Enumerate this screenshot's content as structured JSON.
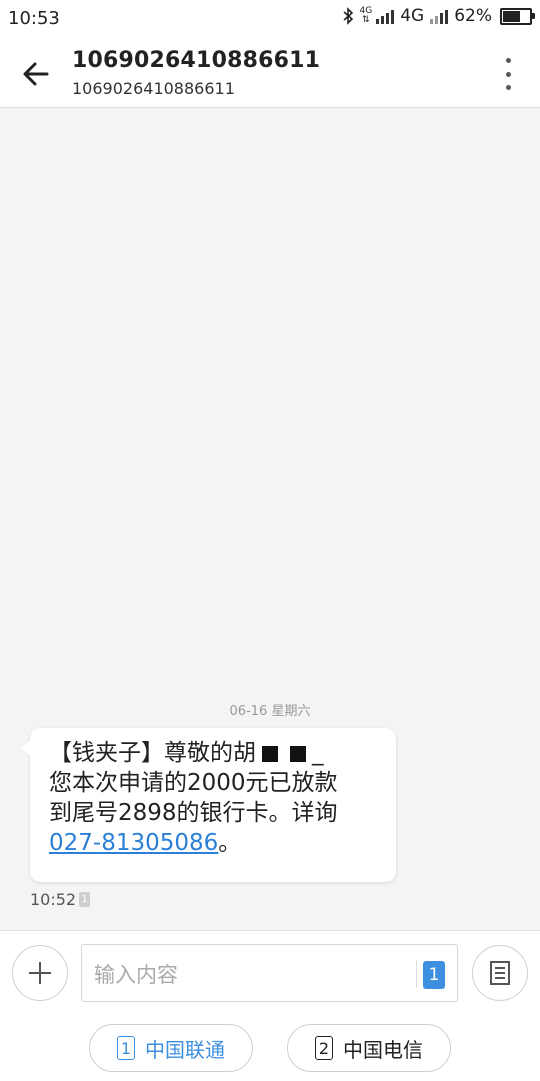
{
  "status_bar": {
    "time": "10:53",
    "network_small": "4G",
    "network": "4G",
    "battery_text": "62%",
    "battery_level": 0.62
  },
  "header": {
    "title": "1069026410886611",
    "subtitle": "1069026410886611"
  },
  "conversation": {
    "date_label": "06-16  星期六",
    "message": {
      "line1": "【钱夹子】尊敬的胡",
      "line1_tail": "_",
      "line2": "您本次申请的2000元已放款",
      "line3": "到尾号2898的银行卡。详询",
      "link": "027-81305086",
      "line4_suffix": "。",
      "time": "10:52",
      "sim_badge": "1"
    }
  },
  "input": {
    "placeholder": "输入内容",
    "sim_badge": "1"
  },
  "sim_buttons": [
    {
      "number": "1",
      "label": "中国联通"
    },
    {
      "number": "2",
      "label": "中国电信"
    }
  ],
  "colors": {
    "accent": "#3d8fe0",
    "link": "#2b7fd6",
    "background": "#f4f4f4"
  }
}
